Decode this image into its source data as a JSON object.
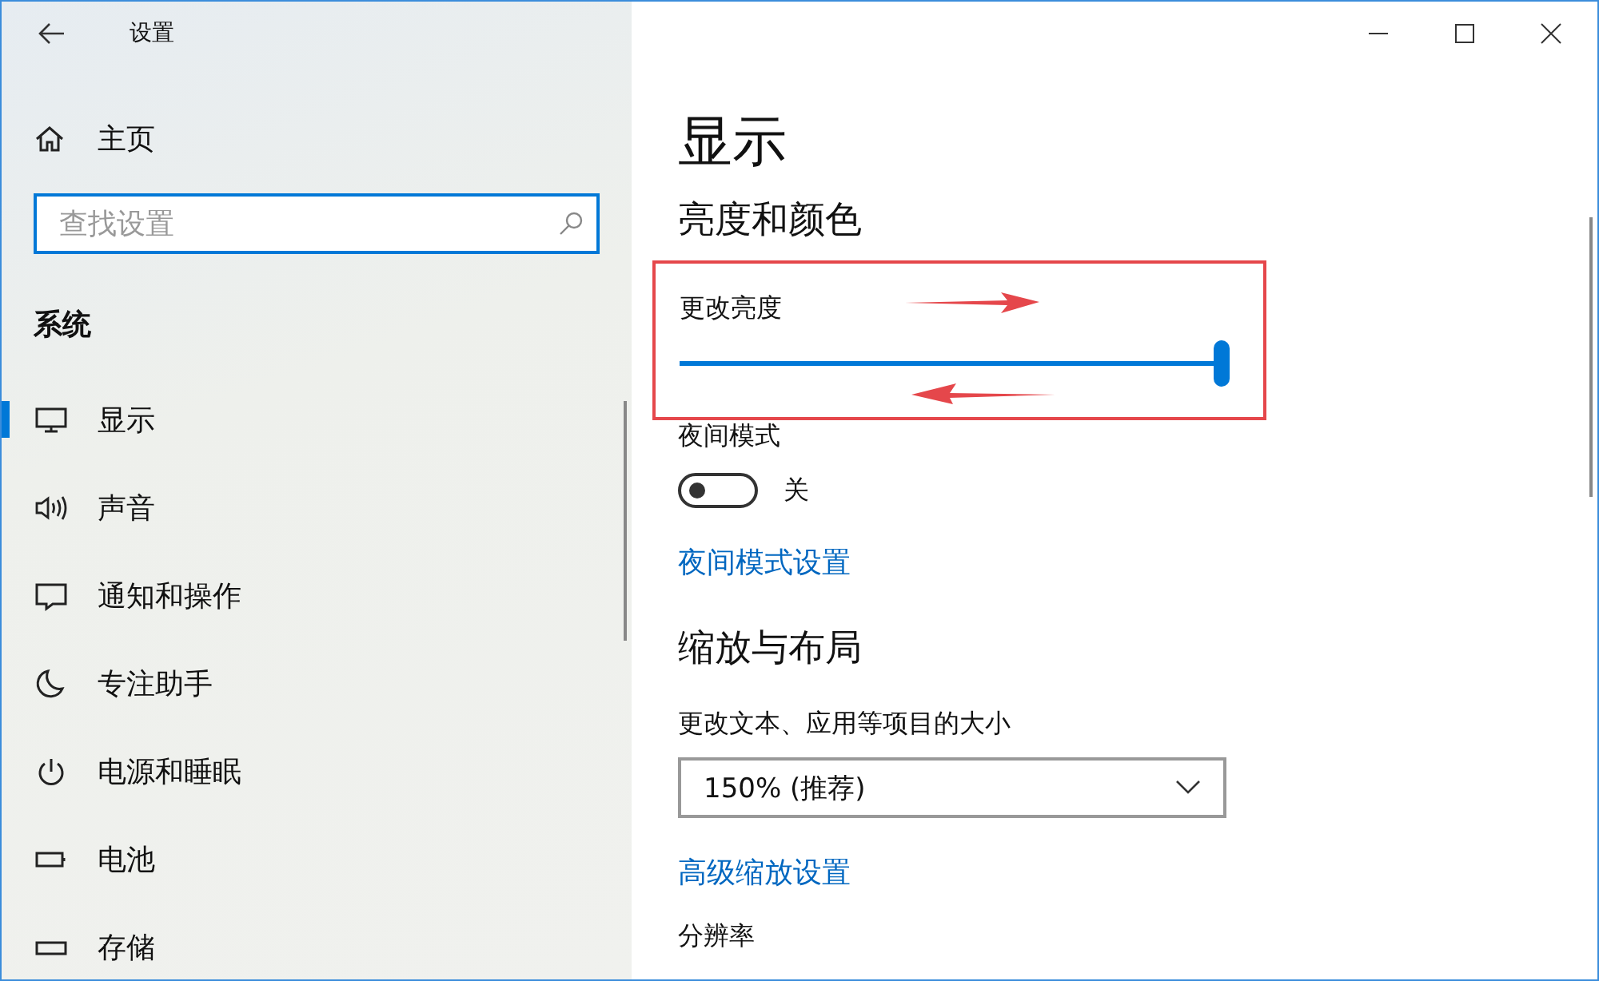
{
  "window": {
    "title": "设置"
  },
  "sidebar": {
    "home": "主页",
    "search": {
      "placeholder": "查找设置"
    },
    "section": "系统",
    "items": [
      {
        "label": "显示",
        "kind": "monitor",
        "selected": true
      },
      {
        "label": "声音",
        "kind": "speaker",
        "selected": false
      },
      {
        "label": "通知和操作",
        "kind": "message",
        "selected": false
      },
      {
        "label": "专注助手",
        "kind": "moon",
        "selected": false
      },
      {
        "label": "电源和睡眠",
        "kind": "power",
        "selected": false
      },
      {
        "label": "电池",
        "kind": "battery",
        "selected": false
      },
      {
        "label": "存储",
        "kind": "storage",
        "selected": false
      }
    ]
  },
  "page": {
    "title": "显示",
    "brightness_heading": "亮度和颜色",
    "brightness": {
      "label": "更改亮度",
      "level": 1.0
    },
    "night_light": {
      "label": "夜间模式",
      "on": false,
      "state_text": "关"
    },
    "night_light_link": "夜间模式设置",
    "scale_heading": "缩放与布局",
    "scale_label": "更改文本、应用等项目的大小",
    "scale_value": "150% (推荐)",
    "advanced_link": "高级缩放设置",
    "resolution_label": "分辨率"
  }
}
